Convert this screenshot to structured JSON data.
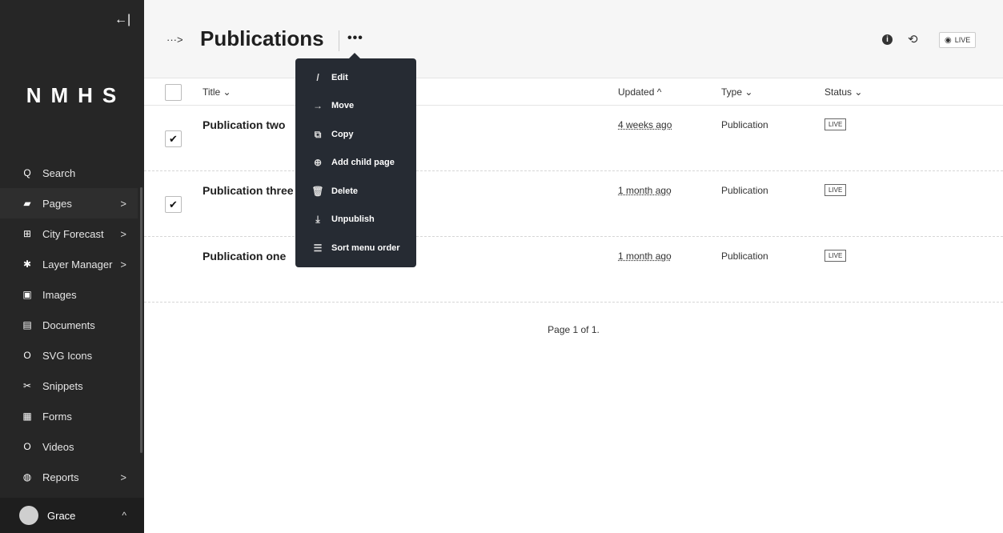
{
  "sidebar": {
    "collapse_glyph": "←|",
    "logo": "NMHS",
    "items": [
      {
        "label": "Search",
        "icon": "Q",
        "chevron": ""
      },
      {
        "label": "Pages",
        "icon": "▰",
        "chevron": ">"
      },
      {
        "label": "City Forecast",
        "icon": "⊞",
        "chevron": ">"
      },
      {
        "label": "Layer Manager",
        "icon": "✱",
        "chevron": ">"
      },
      {
        "label": "Images",
        "icon": "▣",
        "chevron": ""
      },
      {
        "label": "Documents",
        "icon": "▤",
        "chevron": ""
      },
      {
        "label": "SVG Icons",
        "icon": "O",
        "chevron": ""
      },
      {
        "label": "Snippets",
        "icon": "✂",
        "chevron": ""
      },
      {
        "label": "Forms",
        "icon": "▦",
        "chevron": ""
      },
      {
        "label": "Videos",
        "icon": "O",
        "chevron": ""
      },
      {
        "label": "Reports",
        "icon": "◍",
        "chevron": ">"
      }
    ],
    "user": {
      "name": "Grace",
      "chevron": "^"
    }
  },
  "header": {
    "breadcrumb": "···>",
    "title": "Publications",
    "more": "•••",
    "info_glyph": "i",
    "history_glyph": "⟲",
    "live_eye": "◉",
    "live_label": "LIVE"
  },
  "table": {
    "headers": {
      "title": "Title ⌄",
      "updated": "Updated ^",
      "type": "Type ⌄",
      "status": "Status ⌄"
    },
    "rows": [
      {
        "title": "Publication two",
        "updated": "4 weeks ago",
        "type": "Publication",
        "status": "LIVE",
        "checked": "✔"
      },
      {
        "title": "Publication three",
        "updated": "1 month ago",
        "type": "Publication",
        "status": "LIVE",
        "checked": "✔"
      },
      {
        "title": "Publication one",
        "updated": "1 month ago",
        "type": "Publication",
        "status": "LIVE",
        "checked": ""
      }
    ],
    "pagination": "Page 1 of 1."
  },
  "dropdown": {
    "items": [
      {
        "label": "Edit",
        "icon": "/"
      },
      {
        "label": "Move",
        "icon": "→"
      },
      {
        "label": "Copy",
        "icon": "⧉"
      },
      {
        "label": "Add child page",
        "icon": "⊕"
      },
      {
        "label": "Delete",
        "icon": "🗑"
      },
      {
        "label": "Unpublish",
        "icon": "⤓"
      },
      {
        "label": "Sort menu order",
        "icon": "☰"
      }
    ]
  }
}
